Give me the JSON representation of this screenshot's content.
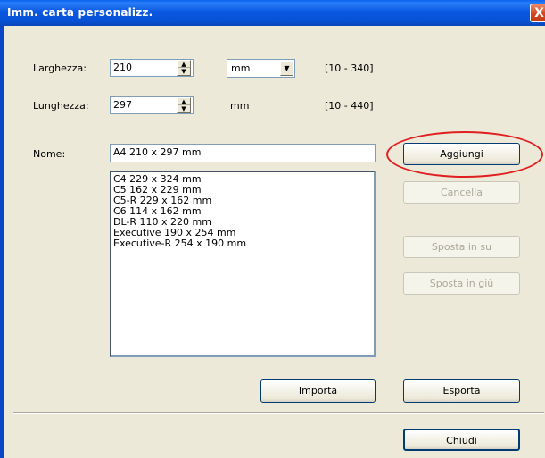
{
  "window": {
    "title": "Imm. carta personalizz.",
    "close_label": "X"
  },
  "form": {
    "width_label": "Larghezza:",
    "width_value": "210",
    "unit_select_value": "mm",
    "width_range": "[10 - 340]",
    "length_label": "Lunghezza:",
    "length_value": "297",
    "length_unit": "mm",
    "length_range": "[10 - 440]",
    "name_label": "Nome:",
    "name_value": "A4 210 x 297 mm"
  },
  "paper_list": [
    "C4 229 x 324 mm",
    "C5 162 x 229 mm",
    "C5-R 229 x 162 mm",
    "C6 114 x 162 mm",
    "DL-R 110 x 220 mm",
    "Executive 190 x 254 mm",
    "Executive-R 254 x 190 mm"
  ],
  "buttons": {
    "add": "Aggiungi",
    "delete": "Cancella",
    "move_up": "Sposta in su",
    "move_down": "Sposta in giù",
    "import": "Importa",
    "export": "Esporta",
    "close": "Chiudi"
  },
  "annotation_color": "#e02020"
}
